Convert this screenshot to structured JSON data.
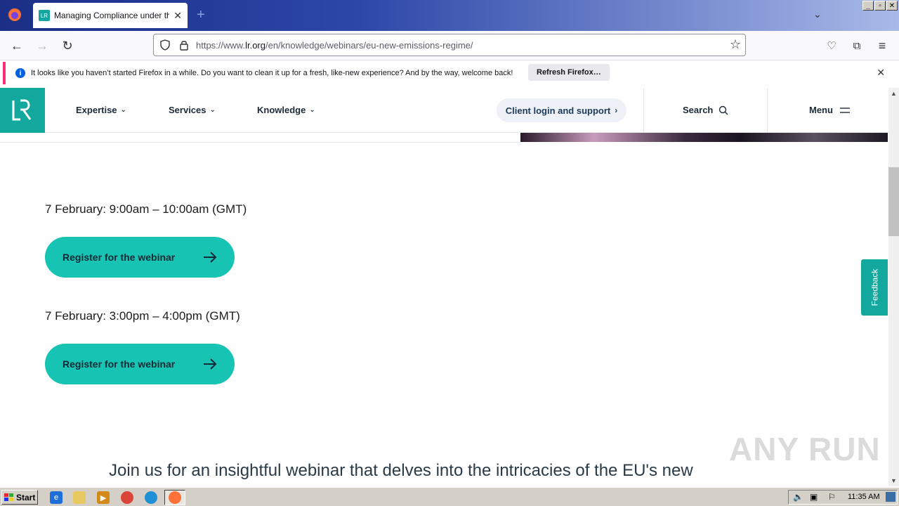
{
  "browser": {
    "tab_title": "Managing Compliance under the EU",
    "tab_favicon_text": "LR",
    "url_prefix": "https://www.",
    "url_domain": "lr.org",
    "url_path": "/en/knowledge/webinars/eu-new-emissions-regime/"
  },
  "notification": {
    "message": "It looks like you haven’t started Firefox in a while. Do you want to clean it up for a fresh, like-new experience? And by the way, welcome back!",
    "button_label": "Refresh Firefox…"
  },
  "site_header": {
    "logo_text": "LR",
    "nav_items": [
      "Expertise",
      "Services",
      "Knowledge"
    ],
    "client_login_label": "Client login and support",
    "search_label": "Search",
    "menu_label": "Menu"
  },
  "sessions": [
    {
      "date": "7 February: 9:00am – 10:00am (GMT)",
      "button_label": "Register for the webinar"
    },
    {
      "date": "7 February: 3:00pm – 4:00pm (GMT)",
      "button_label": "Register for the webinar"
    }
  ],
  "intro_text": "Join us for an insightful webinar that delves into the intricacies of the EU's new",
  "feedback_label": "Feedback",
  "watermark": "ANY RUN",
  "taskbar": {
    "start_label": "Start",
    "clock": "11:35 AM"
  },
  "colors": {
    "brand_teal": "#13a89e",
    "button_teal": "#17c3b2"
  }
}
